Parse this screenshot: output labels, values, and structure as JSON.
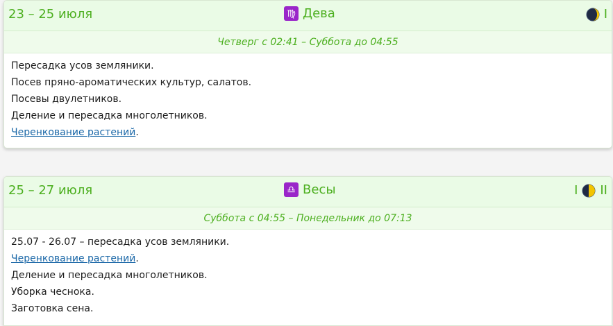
{
  "cards": [
    {
      "date_range": "23 – 25 июля",
      "sign": {
        "name": "Дева",
        "symbol": "♍",
        "icon": "virgo-icon"
      },
      "phase": {
        "before": "",
        "after": "I",
        "moon_icon": "waxing-crescent-moon-icon"
      },
      "time": "Четверг с 02:41 – Суббота до 04:55",
      "items": [
        {
          "text": "Пересадка усов земляники."
        },
        {
          "text": "Посев пряно-ароматических культур, салатов."
        },
        {
          "text": "Посевы двулетников."
        },
        {
          "text": "Деление и пересадка многолетников."
        },
        {
          "link": "Черенкование растений",
          "suffix": "."
        }
      ]
    },
    {
      "date_range": "25 – 27 июля",
      "sign": {
        "name": "Весы",
        "symbol": "♎",
        "icon": "libra-icon"
      },
      "phase": {
        "before": "I",
        "after": "II",
        "moon_icon": "first-quarter-moon-icon"
      },
      "time": "Суббота с 04:55 – Понедельник до 07:13",
      "items": [
        {
          "text": "25.07 - 26.07 – пересадка усов земляники."
        },
        {
          "link": "Черенкование растений",
          "suffix": "."
        },
        {
          "text": "Деление и пересадка многолетников."
        },
        {
          "text": "Уборка чеснока."
        },
        {
          "text": "Заготовка сена."
        }
      ]
    }
  ],
  "colors": {
    "accent_green": "#4caf1f",
    "header_bg": "#eafbe6",
    "sign_icon_bg": "#9a26c9",
    "link": "#1a67a7"
  }
}
